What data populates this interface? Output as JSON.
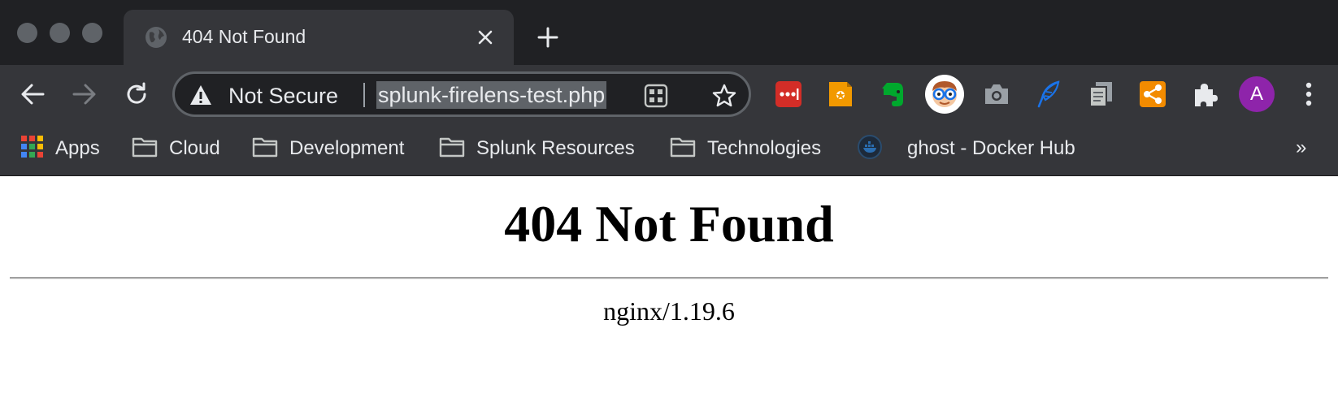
{
  "window": {
    "traffic_lights": [
      "close",
      "minimize",
      "maximize"
    ]
  },
  "tab": {
    "title": "404 Not Found",
    "favicon": "globe-icon"
  },
  "omnibox": {
    "security_label": "Not Secure",
    "url": "splunk-firelens-test.php"
  },
  "extensions": [
    {
      "name": "lastpass-icon",
      "color": "#d32d27"
    },
    {
      "name": "keep-icon",
      "color": "#f29900"
    },
    {
      "name": "evernote-icon",
      "color": "#00a82d"
    },
    {
      "name": "nerd-face-icon",
      "color": "#ffffff"
    },
    {
      "name": "camera-icon",
      "color": "#9aa0a6"
    },
    {
      "name": "feather-icon",
      "color": "#1a73e8"
    },
    {
      "name": "copy-icon",
      "color": "#9aa0a6"
    },
    {
      "name": "share-icon",
      "color": "#f28b00"
    },
    {
      "name": "puzzle-icon",
      "color": "#e8eaed"
    }
  ],
  "profile": {
    "initial": "A",
    "color": "#8e24aa"
  },
  "bookmarks": [
    {
      "label": "Apps",
      "icon": "apps-grid-icon"
    },
    {
      "label": "Cloud",
      "icon": "folder-icon"
    },
    {
      "label": "Development",
      "icon": "folder-icon"
    },
    {
      "label": "Splunk Resources",
      "icon": "folder-icon"
    },
    {
      "label": "Technologies",
      "icon": "folder-icon"
    },
    {
      "label": "ghost - Docker Hub",
      "icon": "docker-icon"
    }
  ],
  "bookmarks_more": "»",
  "page": {
    "heading": "404 Not Found",
    "server": "nginx/1.19.6"
  },
  "colors": {
    "frame": "#202124",
    "toolbar": "#35363a",
    "text": "#e8eaed"
  }
}
